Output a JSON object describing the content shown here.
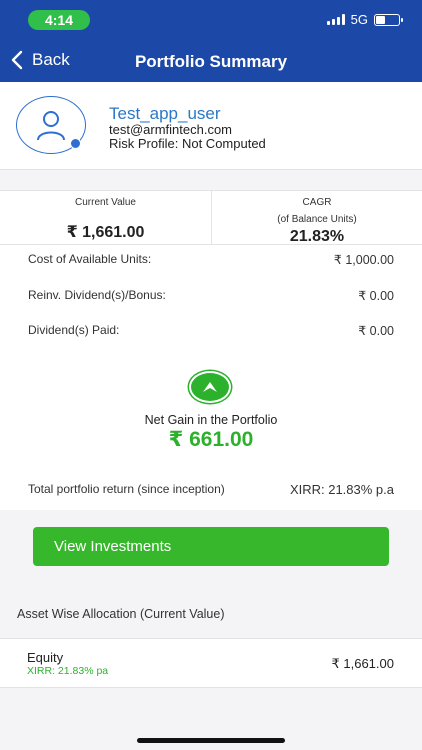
{
  "status_bar": {
    "time": "4:14",
    "network": "5G"
  },
  "nav": {
    "back_label": "Back",
    "title": "Portfolio Summary"
  },
  "profile": {
    "name": "Test_app_user",
    "email": "test@armfintech.com",
    "risk_profile": "Risk Profile: Not Computed"
  },
  "summary": {
    "current_value_label": "Current Value",
    "current_value": "₹ 1,661.00",
    "cagr_label_line1": "CAGR",
    "cagr_label_line2": "(of Balance Units)",
    "cagr_value": "21.83%",
    "rows": [
      {
        "label": "Cost of Available Units:",
        "value": "₹ 1,000.00"
      },
      {
        "label": "Reinv. Dividend(s)/Bonus:",
        "value": "₹ 0.00"
      },
      {
        "label": "Dividend(s) Paid:",
        "value": "₹ 0.00"
      }
    ],
    "net_gain_label": "Net Gain in the Portfolio",
    "net_gain_value": "₹ 661.00",
    "total_return_label": "Total portfolio return (since inception)",
    "total_return_value": "XIRR: 21.83% p.a"
  },
  "actions": {
    "view_investments_label": "View Investments"
  },
  "allocation": {
    "heading": "Asset Wise Allocation (Current Value)",
    "items": [
      {
        "name": "Equity",
        "xirr": "XIRR: 21.83% pa",
        "value": "₹ 1,661.00"
      }
    ]
  },
  "colors": {
    "header": "#1c48a7",
    "accent_green": "#36b72c",
    "link_blue": "#2a78c6"
  }
}
